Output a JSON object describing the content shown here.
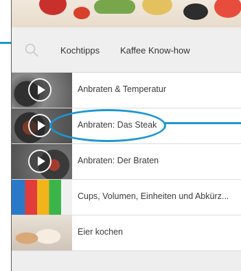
{
  "toolbar": {
    "search_icon": "search-icon",
    "links": [
      "Kochtipps",
      "Kaffee Know-how"
    ]
  },
  "items": [
    {
      "label": "Anbraten & Temperatur",
      "video": true
    },
    {
      "label": "Anbraten: Das Steak",
      "video": true
    },
    {
      "label": "Anbraten: Der Braten",
      "video": true
    },
    {
      "label": "Cups, Volumen, Einheiten und Abkürz...",
      "video": false
    },
    {
      "label": "Eier kochen",
      "video": false
    }
  ],
  "colors": {
    "accent": "#1c96d2"
  }
}
